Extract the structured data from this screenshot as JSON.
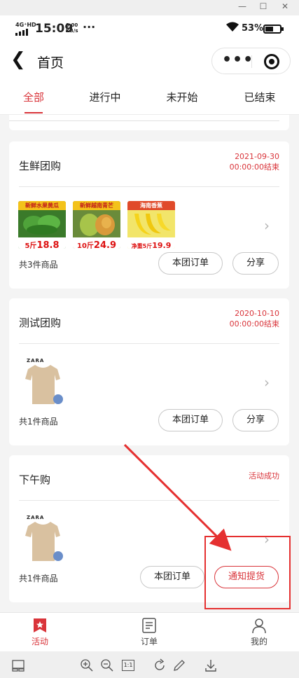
{
  "status_bar": {
    "network": "4G⁺HD",
    "time": "15:09",
    "speed_value": "0.00",
    "speed_unit": "KB/s",
    "battery_text": "53%",
    "battery_level": 0.53
  },
  "nav": {
    "title": "首页"
  },
  "tabs": [
    {
      "label": "全部",
      "active": true
    },
    {
      "label": "进行中",
      "active": false
    },
    {
      "label": "未开始",
      "active": false
    },
    {
      "label": "已结束",
      "active": false
    }
  ],
  "cards": [
    {
      "title": "生鲜团购",
      "status_line1": "2021-09-30",
      "status_line2": "00:00:00结束",
      "products": [
        {
          "banner": "新鲜水果黄瓜",
          "price_prefix": "5斤",
          "price": "18.8",
          "kind": "cucumber"
        },
        {
          "banner": "新鲜越南青芒",
          "price_prefix": "10斤",
          "price": "24.9",
          "kind": "mango"
        },
        {
          "banner": "海南香蕉",
          "price_prefix": "净重5斤",
          "price": "19.9",
          "kind": "banana"
        }
      ],
      "count": "共3件商品",
      "btn1": "本团订单",
      "btn2": "分享"
    },
    {
      "title": "测试团购",
      "status_line1": "2020-10-10",
      "status_line2": "00:00:00结束",
      "products": [
        {
          "brand": "ZARA",
          "kind": "tshirt"
        }
      ],
      "count": "共1件商品",
      "btn1": "本团订单",
      "btn2": "分享"
    },
    {
      "title": "下午购",
      "status_line1": "活动成功",
      "products": [
        {
          "brand": "ZARA",
          "kind": "tshirt"
        }
      ],
      "count": "共1件商品",
      "btn1": "本团订单",
      "btn2": "通知提货"
    }
  ],
  "bottom_nav": [
    {
      "label": "活动",
      "icon": "star-flag-icon",
      "active": true
    },
    {
      "label": "订单",
      "icon": "document-icon",
      "active": false
    },
    {
      "label": "我的",
      "icon": "person-icon",
      "active": false
    }
  ],
  "viewer_toolbar": {
    "zoom_box": "1:1"
  },
  "colors": {
    "accent": "#d9343a",
    "annotation": "#e53030"
  }
}
